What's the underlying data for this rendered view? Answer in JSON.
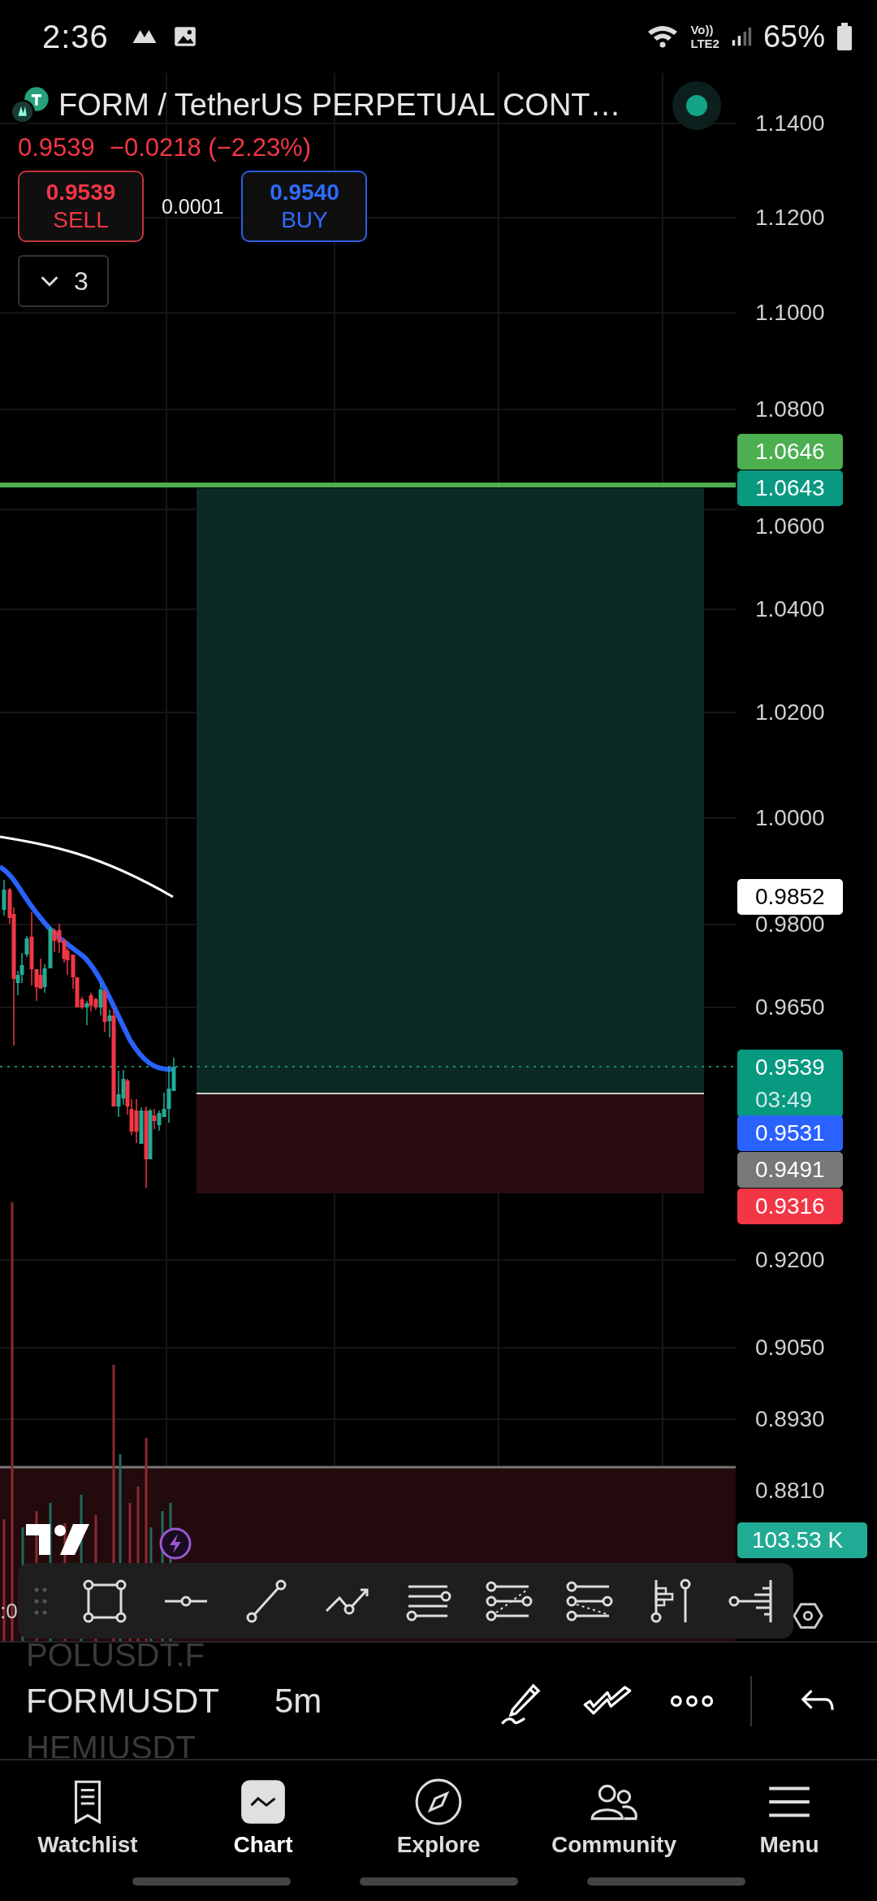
{
  "status_bar": {
    "time": "2:36",
    "volte": "Vo))",
    "network": "LTE2",
    "battery": "65%"
  },
  "header": {
    "title": "FORM / TetherUS PERPETUAL CONT…",
    "live": true,
    "price": "0.9539",
    "change": "−0.0218 (−2.23%)"
  },
  "sell": {
    "price": "0.9539",
    "label": "SELL"
  },
  "spread": "0.0001",
  "buy": {
    "price": "0.9540",
    "label": "BUY"
  },
  "indicators_toggle": {
    "count": "3",
    "expanded": false
  },
  "price_axis": [
    "1.1400",
    "1.1200",
    "1.1000",
    "1.0800",
    "1.0600",
    "1.0400",
    "1.0200",
    "1.0000",
    "0.9800",
    "0.9650",
    "0.9200",
    "0.9050",
    "0.8930",
    "0.8810"
  ],
  "price_tags": [
    {
      "label": "1.0646",
      "color": "#4caf50"
    },
    {
      "label": "1.0643",
      "color": "#089981"
    },
    {
      "label": "0.9852",
      "color": "#ffffff"
    },
    {
      "label": "0.9539",
      "countdown": "03:49",
      "color": "#089981"
    },
    {
      "label": "0.9531",
      "color": "#2962ff"
    },
    {
      "label": "0.9491",
      "color": "#787878"
    },
    {
      "label": "0.9316",
      "color": "#f23645"
    }
  ],
  "volume_tag": {
    "label": "103.53 K",
    "color": "#22ab94"
  },
  "time_axis_label": ":0",
  "symbol_picker": {
    "previous": "POLUSDT.F",
    "current": "FORMUSDT",
    "next": "HEMIUSDT"
  },
  "interval": "5m",
  "nav": [
    {
      "label": "Watchlist",
      "kind": "watchlist",
      "selected": false
    },
    {
      "label": "Chart",
      "kind": "chart",
      "selected": true
    },
    {
      "label": "Explore",
      "kind": "explore",
      "selected": false
    },
    {
      "label": "Community",
      "kind": "community",
      "selected": false
    },
    {
      "label": "Menu",
      "kind": "menu",
      "selected": false
    }
  ]
}
